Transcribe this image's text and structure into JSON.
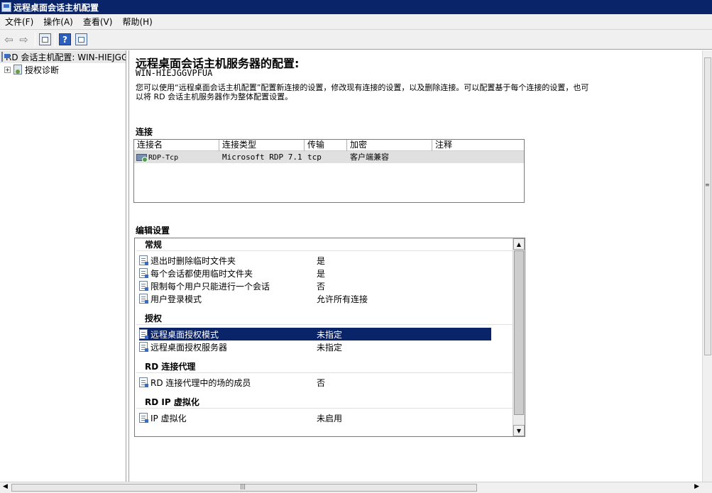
{
  "window": {
    "title": "远程桌面会话主机配置"
  },
  "menu": {
    "file": "文件(F)",
    "action": "操作(A)",
    "view": "查看(V)",
    "help": "帮助(H)"
  },
  "toolbar": {
    "help_glyph": "?"
  },
  "tree": {
    "root_label": "RD 会话主机配置: WIN-HIEJGGVPFUA",
    "child_label": "授权诊断",
    "child_expander": "+"
  },
  "main": {
    "title": "远程桌面会话主机服务器的配置:",
    "server": "WIN-HIEJGGVPFUA",
    "description": "您可以使用“远程桌面会话主机配置”配置新连接的设置，修改现有连接的设置，以及删除连接。可以配置基于每个连接的设置，也可以将 RD 会话主机服务器作为整体配置设置。",
    "connections_label": "连接",
    "edit_settings_label": "编辑设置"
  },
  "connections": {
    "columns": [
      "连接名",
      "连接类型",
      "传输",
      "加密",
      "注释"
    ],
    "rows": [
      {
        "name": "RDP-Tcp",
        "type": "Microsoft RDP 7.1",
        "transport": "tcp",
        "encryption": "客户端兼容",
        "comment": ""
      }
    ]
  },
  "settings": {
    "groups": [
      {
        "title": "常规",
        "items": [
          {
            "name": "退出时删除临时文件夹",
            "value": "是"
          },
          {
            "name": "每个会话都使用临时文件夹",
            "value": "是"
          },
          {
            "name": "限制每个用户只能进行一个会话",
            "value": "否"
          },
          {
            "name": "用户登录模式",
            "value": "允许所有连接"
          }
        ]
      },
      {
        "title": "授权",
        "items": [
          {
            "name": "远程桌面授权模式",
            "value": "未指定",
            "selected": true
          },
          {
            "name": "远程桌面授权服务器",
            "value": "未指定"
          }
        ]
      },
      {
        "title": "RD 连接代理",
        "items": [
          {
            "name": "RD 连接代理中的场的成员",
            "value": "否"
          }
        ]
      },
      {
        "title": "RD IP 虚拟化",
        "items": [
          {
            "name": "IP 虚拟化",
            "value": "未启用"
          }
        ]
      }
    ]
  },
  "scrollbars": {
    "up": "▲",
    "down": "▼",
    "left": "◀",
    "right": "▶",
    "grip_h": "|||",
    "grip_v": "≡"
  }
}
